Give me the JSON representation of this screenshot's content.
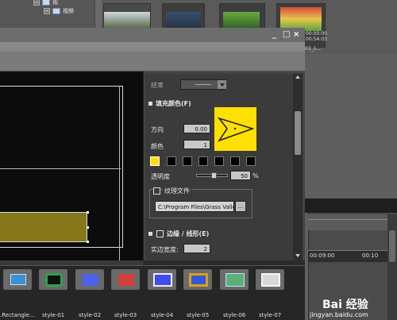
{
  "tree": {
    "row1": "视",
    "row2": "视频"
  },
  "bin_clips": [
    {
      "label": "00:00:00\n00:54:03"
    },
    {
      "label": "03_1..."
    }
  ],
  "timeline": {
    "ticks": [
      "00:09:00",
      "00:10"
    ]
  },
  "window": {
    "minimize": "_",
    "maximize": "□",
    "close": "×"
  },
  "props": {
    "end_label": "结束",
    "fill_section": "填充颜色(F)",
    "direction_label": "方向",
    "direction_value": "0.00",
    "color_label": "颜色",
    "color_value": "1",
    "opacity_label": "透明度",
    "opacity_value": "50",
    "opacity_unit": "%",
    "texture_label": "纹理文件",
    "texture_path": "C:\\Program Files\\Grass Valley\\",
    "browse": "...",
    "edge_section": "边缘 / 线形(E)",
    "edge_width_label": "实边宽度:",
    "edge_width_value": "2",
    "fill_color": "#ffe000"
  },
  "styles": [
    {
      "label": ".Rectangle...",
      "icon": "envelope-icon"
    },
    {
      "label": "style-01"
    },
    {
      "label": "style-02"
    },
    {
      "label": "style-03"
    },
    {
      "label": "style-04"
    },
    {
      "label": "style-05"
    },
    {
      "label": "style-06"
    },
    {
      "label": "style-07"
    }
  ],
  "watermark": {
    "text": "Bai 经验",
    "url": "jingyan.baidu.com"
  }
}
